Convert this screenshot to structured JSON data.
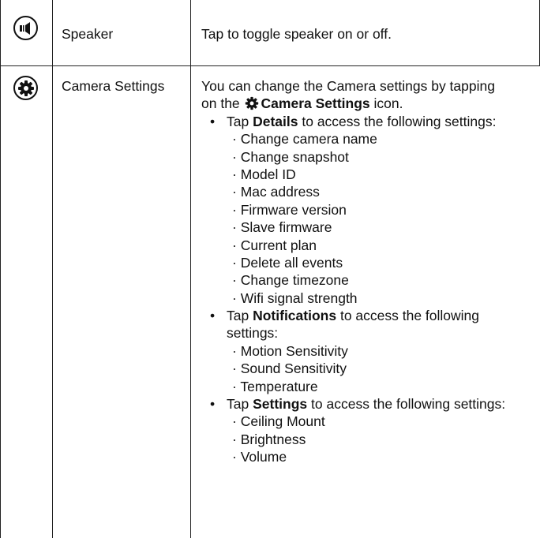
{
  "rows": [
    {
      "icon": "speaker-icon",
      "label": "Speaker",
      "description": "Tap to toggle speaker on or off."
    },
    {
      "icon": "gear-icon",
      "label": "Camera Settings",
      "intro_line1": "You can change the Camera settings by tapping",
      "intro_on": "on the",
      "intro_link": "Camera Settings",
      "intro_end": "icon.",
      "groups": [
        {
          "tap": "Tap",
          "keyword": "Details",
          "rest": "to access the following settings:",
          "items": [
            "Change camera name",
            "Change snapshot",
            "Model ID",
            "Mac address",
            "Firmware version",
            "Slave firmware",
            "Current plan",
            "Delete all events",
            "Change timezone",
            "Wifi signal strength"
          ]
        },
        {
          "tap": "Tap",
          "keyword": "Notifications",
          "rest": "to access the following",
          "rest2": "settings:",
          "items": [
            "Motion Sensitivity",
            "Sound Sensitivity",
            "Temperature"
          ]
        },
        {
          "tap": "Tap",
          "keyword": "Settings",
          "rest": "to access the following settings:",
          "items": [
            "Ceiling Mount",
            "Brightness",
            "Volume"
          ]
        }
      ]
    }
  ],
  "bullet_char": "•",
  "sub_bullet_char": "·"
}
